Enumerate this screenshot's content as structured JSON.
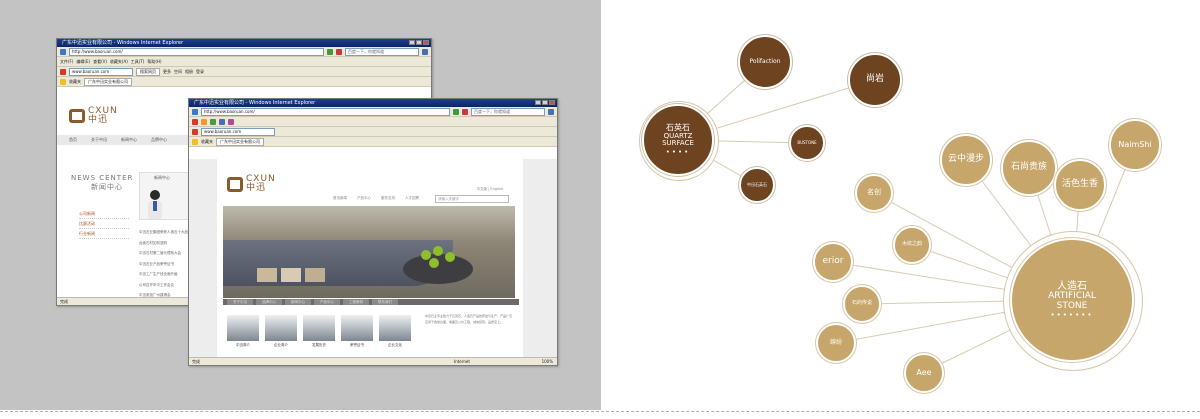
{
  "colors": {
    "panel_bg": "#c3c3c3",
    "brand_brown": "#6d4320",
    "brand_gold": "#c6a66a"
  },
  "browser_back": {
    "title": "广东中迅实业有限公司 - Windows Internet Explorer",
    "address": "http://www.baoruan.com/",
    "search_placeholder": "百度一下，你就知道",
    "menu": [
      "文件(F)",
      "编辑(E)",
      "查看(V)",
      "收藏夹(A)",
      "工具(T)",
      "帮助(H)"
    ],
    "address2": "www.baoruan.com",
    "toolbar": [
      "搜索网页",
      "更多",
      "空间",
      "相册",
      "登录"
    ],
    "tab": "广东中迅实业有限公司",
    "favorites": "收藏夹",
    "logo_text": "CXUN",
    "logo_cn": "中迅",
    "nav": [
      "首页",
      "关于中迅",
      "新闻中心",
      "品牌中心"
    ],
    "news_en": "NEWS CENTER",
    "news_cn": "新闻中心",
    "box_title": "新闻中心",
    "side": [
      "公司新闻",
      "比赛活动",
      "行业新闻"
    ],
    "list": [
      "中迅石业集团荣获人造石十大品牌",
      "台面石材如何选购",
      "中迅石材第二届代理商大会",
      "中迅石业产品荣誉证书",
      "中迅工厂生产线全面升级",
      "公司召开年中工作会议",
      "中迅参加广州建博会"
    ],
    "status": "完成"
  },
  "browser_front": {
    "title": "广东中迅实业有限公司 - Windows Internet Explorer",
    "address": "http://www.baoruan.com/",
    "search_placeholder": "百度一下，你就知道",
    "address2": "www.baoruan.com",
    "tab": "广东中迅实业有限公司",
    "favorites": "收藏夹",
    "logo_text": "CXUN",
    "logo_cn": "中迅",
    "toplinks": "中文版 | English",
    "topnav": [
      "首页新闻",
      "产品中心",
      "服务支持",
      "人才招聘"
    ],
    "search": "请输入关键字",
    "tabs": [
      "关于中迅",
      "品牌中心",
      "新闻中心",
      "产品中心",
      "工程案例",
      "联系我们"
    ],
    "thumbs": [
      "中迅简介",
      "企业简介",
      "发展历史",
      "荣誉证书",
      "企业文化"
    ],
    "text": "中迅石业专业致力于石英石、人造石产品的研发与生产，产品广泛应用于各类台面、墙面及公共工程，诚信经营，品质至上。",
    "status": "完成",
    "zone": "Internet",
    "zoom": "100%"
  },
  "diagram": {
    "hub_left": {
      "cn": "石英石",
      "en1": "QUARTZ",
      "en2": "SURFACE",
      "dots": "••••"
    },
    "hub_right": {
      "cn": "人造石",
      "en1": "ARTIFICIAL",
      "en2": "STONE",
      "dots": "•••••••"
    },
    "left_satellites": [
      "Polifaction",
      "尚岩",
      "BUSTONE",
      "中迅石英石"
    ],
    "right_satellites": [
      "云中漫步",
      "石尚贵族",
      "活色生香",
      "NaimShi",
      "名创",
      "erior",
      "木纹之韵",
      "石的传说",
      "缤纷",
      "Aee"
    ]
  }
}
